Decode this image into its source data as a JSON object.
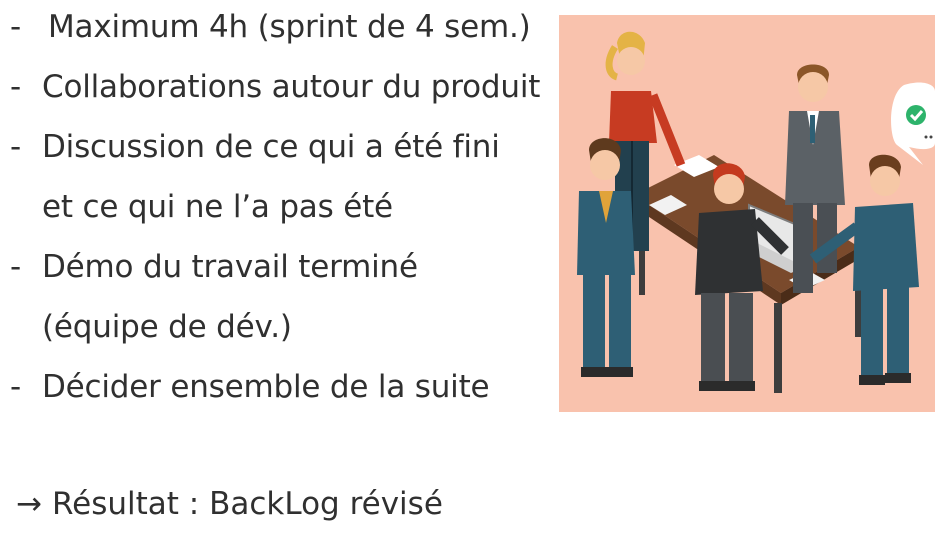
{
  "bullets": [
    {
      "dash": "-",
      "text": "Maximum 4h (sprint de 4 sem.)"
    },
    {
      "dash": "-",
      "text": "Collaborations autour du produit"
    },
    {
      "dash": "-",
      "text": "Discussion de ce qui a été fini"
    },
    {
      "dash": "",
      "text": "et ce qui ne l’a pas été"
    },
    {
      "dash": "-",
      "text": "Démo du travail terminé"
    },
    {
      "dash": "",
      "text": "(équipe de dév.)"
    },
    {
      "dash": "-",
      "text": "Décider ensemble de la suite"
    }
  ],
  "result": {
    "arrow": "→",
    "text": "Résultat : BackLog révisé"
  },
  "illustration": {
    "icon": "team-meeting-illustration",
    "background_color": "#f9c2ad",
    "checkmark_color": "#2db36b"
  }
}
